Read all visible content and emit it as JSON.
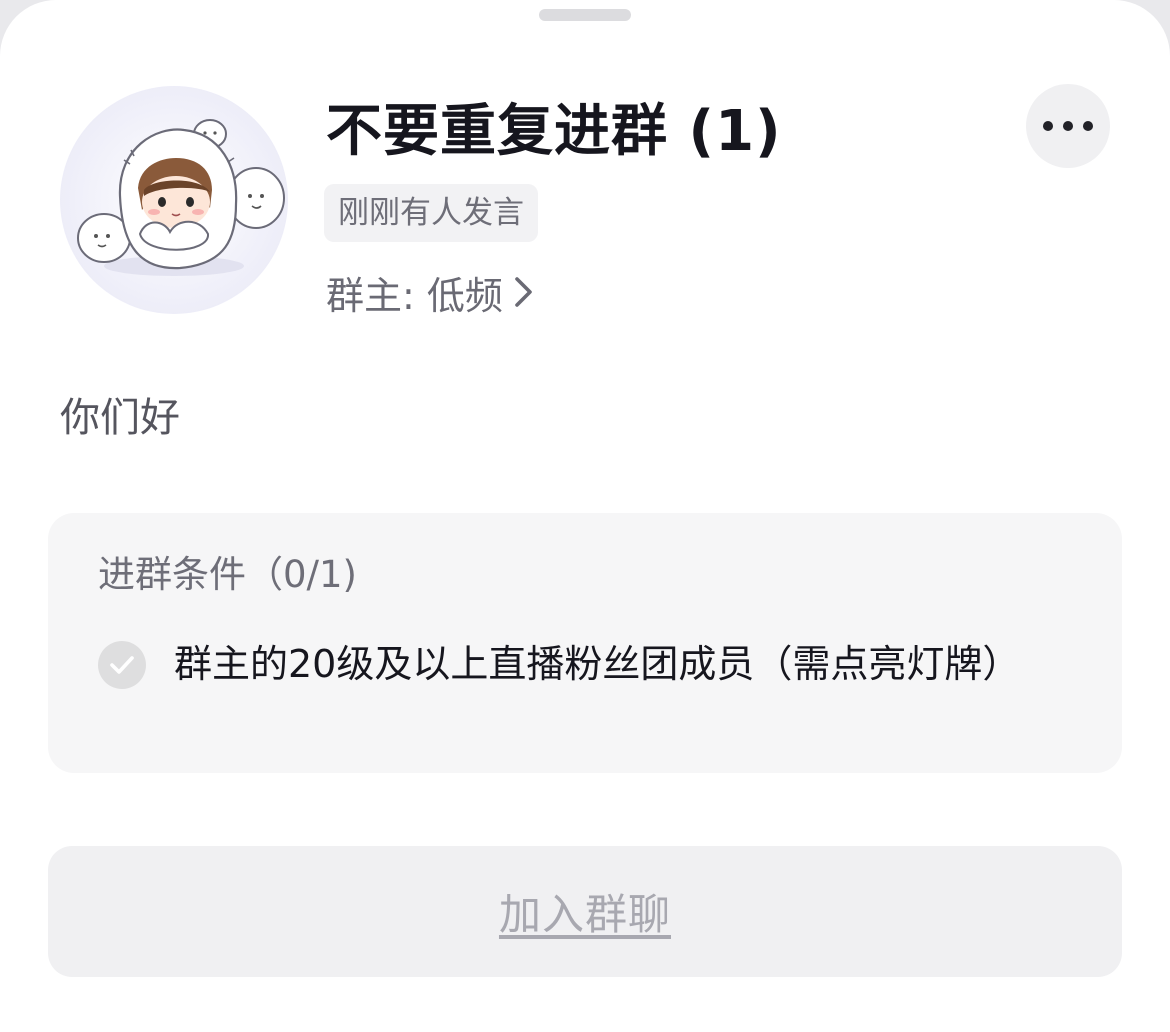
{
  "group": {
    "title": "不要重复进群 (1)",
    "activity_tag": "刚刚有人发言",
    "owner_label": "群主: 低频",
    "intro": "你们好"
  },
  "conditions": {
    "title": "进群条件（0/1)",
    "items": [
      {
        "text": "群主的20级及以上直播粉丝团成员（需点亮灯牌）",
        "met": false
      }
    ]
  },
  "actions": {
    "join_label": "加入群聊"
  },
  "icons": {
    "more": "more-horizontal-icon",
    "chevron": "chevron-right-icon",
    "check": "check-circle-icon"
  },
  "colors": {
    "title": "#16161e",
    "secondary_text": "#6e6e78",
    "card_bg": "#f6f6f7",
    "button_bg": "#f0f0f2",
    "button_text_disabled": "#a8a8b0"
  }
}
